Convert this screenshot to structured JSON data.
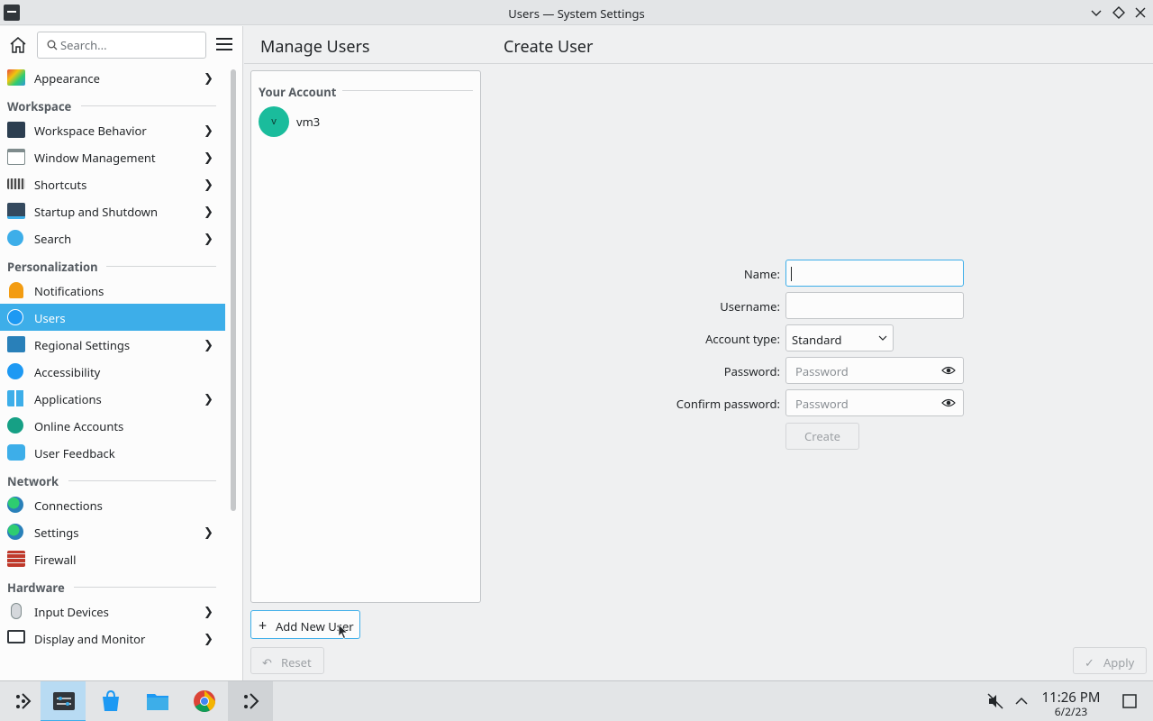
{
  "window": {
    "title": "Users — System Settings"
  },
  "sidebar": {
    "search_placeholder": "Search...",
    "top_item": {
      "label": "Appearance",
      "icon": "appearance-icon",
      "has_children": true
    },
    "sections": [
      {
        "title": "Workspace",
        "items": [
          {
            "label": "Workspace Behavior",
            "icon": "workspace-behavior-icon",
            "has_children": true
          },
          {
            "label": "Window Management",
            "icon": "window-management-icon",
            "has_children": true
          },
          {
            "label": "Shortcuts",
            "icon": "keyboard-icon",
            "has_children": true
          },
          {
            "label": "Startup and Shutdown",
            "icon": "startup-icon",
            "has_children": true
          },
          {
            "label": "Search",
            "icon": "search-icon",
            "has_children": true
          }
        ]
      },
      {
        "title": "Personalization",
        "items": [
          {
            "label": "Notifications",
            "icon": "bell-icon",
            "has_children": false
          },
          {
            "label": "Users",
            "icon": "users-icon",
            "has_children": false,
            "active": true
          },
          {
            "label": "Regional Settings",
            "icon": "regional-icon",
            "has_children": true
          },
          {
            "label": "Accessibility",
            "icon": "accessibility-icon",
            "has_children": false
          },
          {
            "label": "Applications",
            "icon": "applications-icon",
            "has_children": true
          },
          {
            "label": "Online Accounts",
            "icon": "online-accounts-icon",
            "has_children": false
          },
          {
            "label": "User Feedback",
            "icon": "feedback-icon",
            "has_children": false
          }
        ]
      },
      {
        "title": "Network",
        "items": [
          {
            "label": "Connections",
            "icon": "globe-icon",
            "has_children": false
          },
          {
            "label": "Settings",
            "icon": "globe-icon",
            "has_children": true
          },
          {
            "label": "Firewall",
            "icon": "firewall-icon",
            "has_children": false
          }
        ]
      },
      {
        "title": "Hardware",
        "items": [
          {
            "label": "Input Devices",
            "icon": "mouse-icon",
            "has_children": true
          },
          {
            "label": "Display and Monitor",
            "icon": "monitor-icon",
            "has_children": true
          }
        ]
      }
    ]
  },
  "header": {
    "left_title": "Manage Users",
    "right_title": "Create User"
  },
  "accounts": {
    "section_title": "Your Account",
    "user": {
      "initial": "v",
      "name": "vm3"
    },
    "add_button": "Add New User"
  },
  "form": {
    "name_label": "Name:",
    "name_value": "",
    "username_label": "Username:",
    "username_value": "",
    "account_type_label": "Account type:",
    "account_type_value": "Standard",
    "password_label": "Password:",
    "password_placeholder": "Password",
    "confirm_label": "Confirm password:",
    "confirm_placeholder": "Password",
    "create_button": "Create"
  },
  "footer": {
    "reset_button": "Reset",
    "apply_button": "Apply"
  },
  "taskbar": {
    "clock_time": "11:26 PM",
    "clock_date": "6/2/23",
    "items": [
      {
        "name": "launcher-icon"
      },
      {
        "name": "system-settings-icon",
        "state": "active"
      },
      {
        "name": "discover-icon"
      },
      {
        "name": "file-manager-icon"
      },
      {
        "name": "chrome-icon"
      },
      {
        "name": "kde-connect-icon",
        "state": "running"
      }
    ]
  },
  "colors": {
    "accent": "#3daee9",
    "avatar": "#1abc9c",
    "background": "#eff0f1",
    "panel": "#fcfcfc"
  }
}
